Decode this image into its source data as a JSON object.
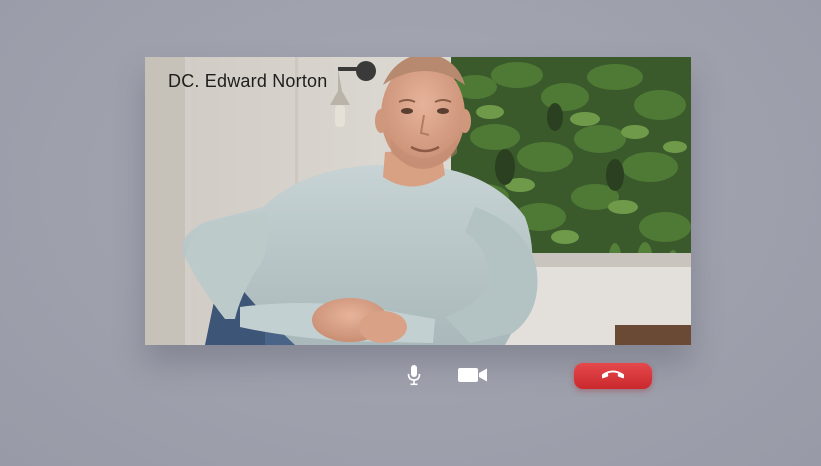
{
  "call": {
    "caller_name": "DC. Edward Norton"
  },
  "controls": {
    "mic_icon": "microphone-icon",
    "camera_icon": "video-camera-icon",
    "hangup_icon": "phone-hangup-icon",
    "hangup_color": "#d9373b"
  }
}
